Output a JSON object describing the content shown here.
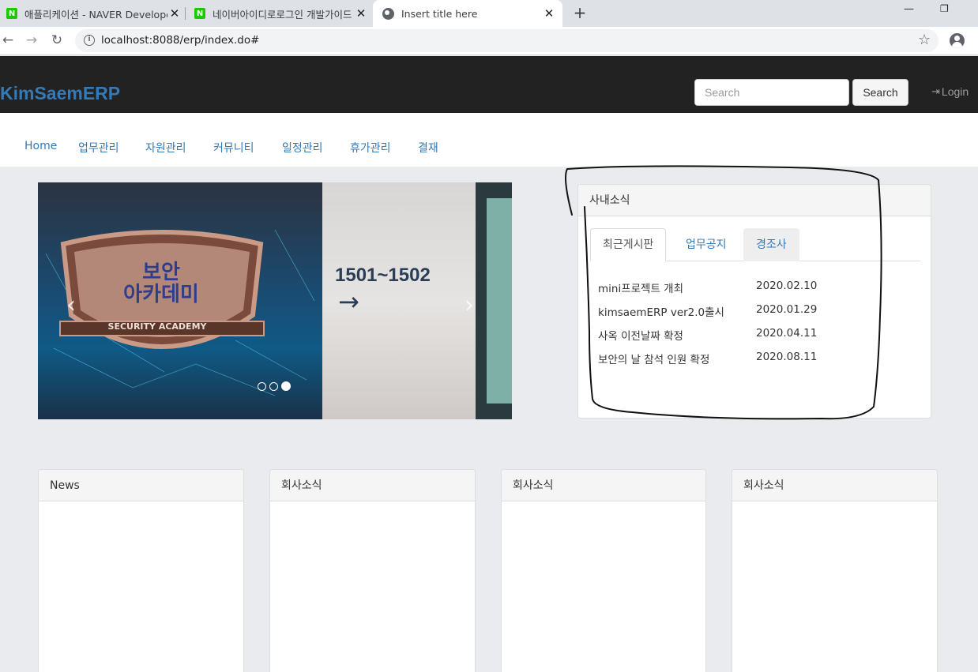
{
  "browser": {
    "tabs": [
      {
        "title": "애플리케이션 - NAVER Developers",
        "favicon": "N"
      },
      {
        "title": "네이버아이디로로그인 개발가이드",
        "favicon": "N"
      },
      {
        "title": "Insert title here"
      }
    ],
    "url": "localhost:8088/erp/index.do#"
  },
  "navbar": {
    "brand": "KimSaemERP",
    "search_placeholder": "Search",
    "search_button": "Search",
    "login": "Login"
  },
  "menu": {
    "items": [
      "Home",
      "업무관리",
      "자원관리",
      "커뮤니티",
      "일정관리",
      "휴가관리",
      "결재"
    ]
  },
  "carousel": {
    "shield_text": "보안\n아카데미",
    "shield_sub": "SECURITY ACADEMY",
    "door_text": "1501~1502",
    "slides": 3,
    "active_slide": 3
  },
  "news_panel": {
    "heading": "사내소식",
    "tabs": [
      "최근게시판",
      "업무공지",
      "경조사"
    ],
    "active_tab": 0,
    "posts": [
      {
        "title": "mini프로젝트 개최",
        "date": "2020.02.10"
      },
      {
        "title": "kimsaemERP ver2.0출시",
        "date": "2020.01.29"
      },
      {
        "title": "사옥 이전날짜 확정",
        "date": "2020.04.11"
      },
      {
        "title": "보안의 날 참석 인원 확정",
        "date": "2020.08.11"
      }
    ]
  },
  "bottom_panels": [
    {
      "heading": "News"
    },
    {
      "heading": "회사소식"
    },
    {
      "heading": "회사소식"
    },
    {
      "heading": "회사소식"
    }
  ],
  "colors": {
    "brand": "#337ab7",
    "navbar_bg": "#222222",
    "page_bg": "#e9ebee"
  }
}
